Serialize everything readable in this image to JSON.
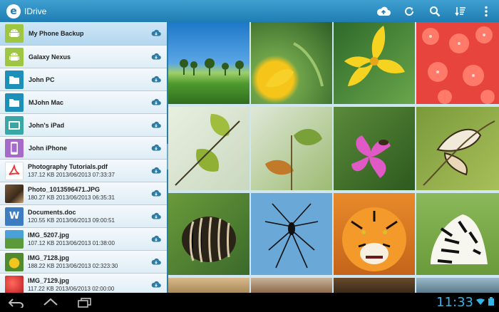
{
  "app": {
    "title": "IDrive",
    "logo_glyph": "e"
  },
  "actions": [
    {
      "name": "upload-cloud-icon"
    },
    {
      "name": "refresh-icon"
    },
    {
      "name": "search-icon"
    },
    {
      "name": "sort-icon"
    },
    {
      "name": "overflow-menu-icon"
    }
  ],
  "sidebar": {
    "devices": [
      {
        "label": "My Phone Backup",
        "icon": "android-icon",
        "selected": true
      },
      {
        "label": "Galaxy Nexus",
        "icon": "android-icon"
      },
      {
        "label": "John PC",
        "icon": "folder-icon"
      },
      {
        "label": "MJohn Mac",
        "icon": "folder-icon"
      },
      {
        "label": "John's iPad",
        "icon": "tablet-icon"
      },
      {
        "label": "John iPhone",
        "icon": "phone-icon"
      }
    ],
    "files": [
      {
        "name": "Photography Tutorials.pdf",
        "size": "137.12 KB",
        "date": "2013/06/2013",
        "time": "07:33:37",
        "icon": "pdf-icon"
      },
      {
        "name": "Photo_1013596471.JPG",
        "size": "180.27 KB",
        "date": "2013/06/2013",
        "time": "06:35:31",
        "icon": "photo-thumbnail"
      },
      {
        "name": "Documents.doc",
        "size": "120.55 KB",
        "date": "2013/06/2013",
        "time": "09:00:51",
        "icon": "word-doc-icon"
      },
      {
        "name": "IMG_5207.jpg",
        "size": "107.12 KB",
        "date": "2013/06/2013",
        "time": "01:38:00",
        "icon": "photo-thumbnail"
      },
      {
        "name": "IMG_7128.jpg",
        "size": "188.22 KB",
        "date": "2013/06/2013",
        "time": "02:323:30",
        "icon": "photo-thumbnail"
      },
      {
        "name": "IMG_7129.jpg",
        "size": "117.22 KB",
        "date": "2013/06/2013",
        "time": "02:00:00",
        "icon": "photo-thumbnail"
      }
    ]
  },
  "photos": [
    {
      "label": "landscape-photo"
    },
    {
      "label": "yellow-flower-photo"
    },
    {
      "label": "yellow-lily-photo"
    },
    {
      "label": "red-flowers-photo"
    },
    {
      "label": "leaves-photo"
    },
    {
      "label": "plant-photo"
    },
    {
      "label": "pink-flower-bee-photo"
    },
    {
      "label": "butterfly-photo"
    },
    {
      "label": "pill-millipede-photo"
    },
    {
      "label": "spider-photo"
    },
    {
      "label": "tiger-photo"
    },
    {
      "label": "zebra-photo"
    },
    {
      "label": "bottom-row-photo-1"
    },
    {
      "label": "bottom-row-photo-2"
    },
    {
      "label": "bottom-row-photo-3"
    },
    {
      "label": "bottom-row-photo-4"
    }
  ],
  "status_bar": {
    "time": "11:33"
  },
  "colors": {
    "accent": "#1f7db3",
    "clock": "#35b5e5"
  }
}
